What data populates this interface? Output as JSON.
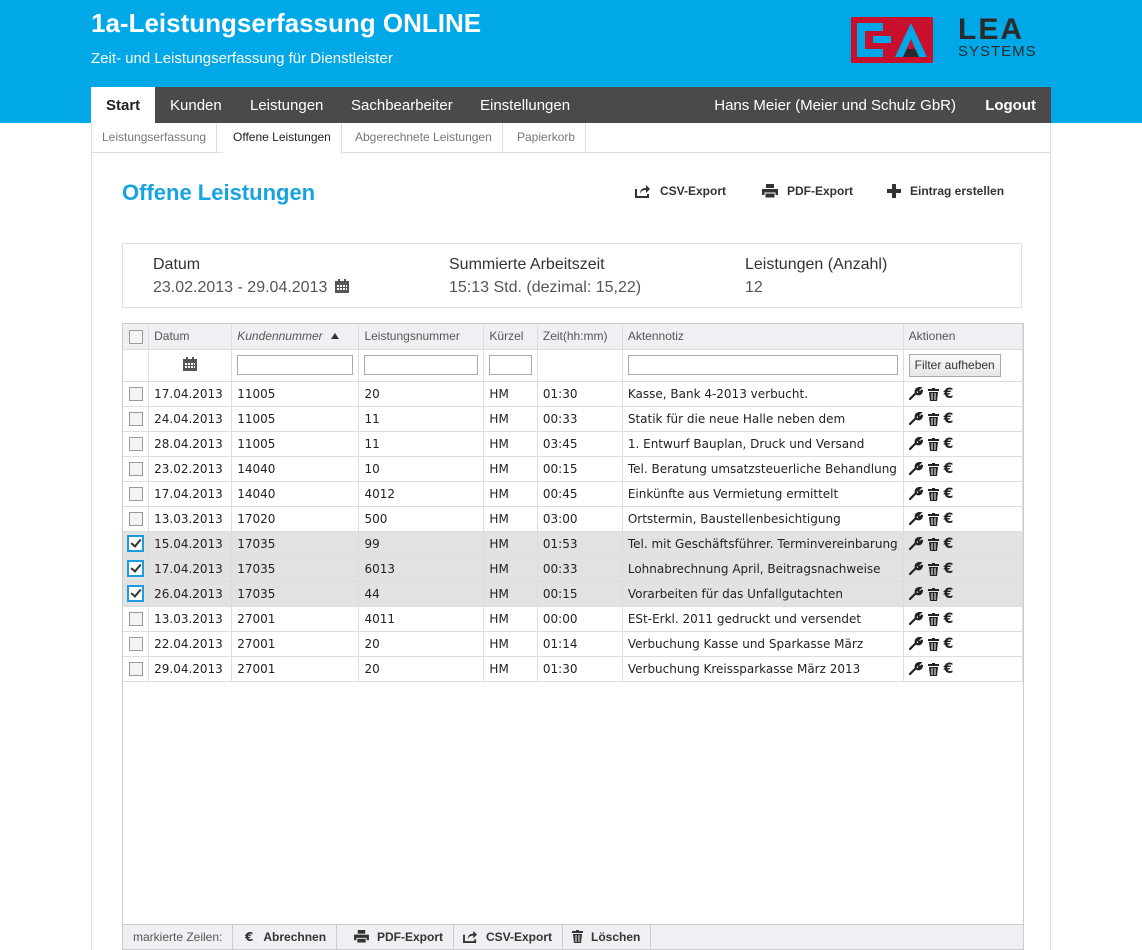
{
  "app": {
    "title": "1a-Leistungserfassung ONLINE",
    "subtitle": "Zeit- und Leistungserfassung für Dienstleister",
    "logo_line1": "LEA",
    "logo_line2": "SYSTEMS",
    "accent_color": "#00a8e8"
  },
  "nav": {
    "items": [
      {
        "label": "Start",
        "active": true
      },
      {
        "label": "Kunden"
      },
      {
        "label": "Leistungen"
      },
      {
        "label": "Sachbearbeiter"
      },
      {
        "label": "Einstellungen"
      }
    ],
    "user": "Hans Meier (Meier und Schulz GbR)",
    "logout": "Logout"
  },
  "subnav": {
    "items": [
      {
        "label": "Leistungserfassung"
      },
      {
        "label": "Offene Leistungen",
        "active": true
      },
      {
        "label": "Abgerechnete Leistungen"
      },
      {
        "label": "Papierkorb"
      }
    ]
  },
  "page": {
    "title": "Offene Leistungen",
    "actions": {
      "csv": "CSV-Export",
      "pdf": "PDF-Export",
      "create": "Eintrag erstellen"
    }
  },
  "summary": {
    "date_label": "Datum",
    "date_value": "23.02.2013 - 29.04.2013",
    "time_label": "Summierte Arbeitszeit",
    "time_value": "15:13 Std. (dezimal: 15,22)",
    "count_label": "Leistungen (Anzahl)",
    "count_value": "12"
  },
  "table": {
    "columns": [
      "Datum",
      "Kundennummer",
      "Leistungsnummer",
      "Kürzel",
      "Zeit(hh:mm)",
      "Aktennotiz",
      "Aktionen"
    ],
    "sorted_column": "Kundennummer",
    "filter_button": "Filter aufheben",
    "rows": [
      {
        "date": "17.04.2013",
        "customer": "11005",
        "service": "20",
        "abbr": "HM",
        "time": "01:30",
        "note": "Kasse, Bank 4-2013 verbucht.",
        "checked": false
      },
      {
        "date": "24.04.2013",
        "customer": "11005",
        "service": "11",
        "abbr": "HM",
        "time": "00:33",
        "note": "Statik für die neue Halle neben dem",
        "checked": false
      },
      {
        "date": "28.04.2013",
        "customer": "11005",
        "service": "11",
        "abbr": "HM",
        "time": "03:45",
        "note": "1. Entwurf Bauplan, Druck und Versand",
        "checked": false
      },
      {
        "date": "23.02.2013",
        "customer": "14040",
        "service": "10",
        "abbr": "HM",
        "time": "00:15",
        "note": "Tel. Beratung umsatzsteuerliche Behandlung",
        "checked": false
      },
      {
        "date": "17.04.2013",
        "customer": "14040",
        "service": "4012",
        "abbr": "HM",
        "time": "00:45",
        "note": "Einkünfte aus Vermietung ermittelt",
        "checked": false
      },
      {
        "date": "13.03.2013",
        "customer": "17020",
        "service": "500",
        "abbr": "HM",
        "time": "03:00",
        "note": "Ortstermin, Baustellenbesichtigung",
        "checked": false
      },
      {
        "date": "15.04.2013",
        "customer": "17035",
        "service": "99",
        "abbr": "HM",
        "time": "01:53",
        "note": "Tel. mit Geschäftsführer. Terminvereinbarung",
        "checked": true
      },
      {
        "date": "17.04.2013",
        "customer": "17035",
        "service": "6013",
        "abbr": "HM",
        "time": "00:33",
        "note": "Lohnabrechnung April, Beitragsnachweise",
        "checked": true
      },
      {
        "date": "26.04.2013",
        "customer": "17035",
        "service": "44",
        "abbr": "HM",
        "time": "00:15",
        "note": "Vorarbeiten für das Unfallgutachten",
        "checked": true
      },
      {
        "date": "13.03.2013",
        "customer": "27001",
        "service": "4011",
        "abbr": "HM",
        "time": "00:00",
        "note": "ESt-Erkl. 2011 gedruckt und versendet",
        "checked": false
      },
      {
        "date": "22.04.2013",
        "customer": "27001",
        "service": "20",
        "abbr": "HM",
        "time": "01:14",
        "note": "Verbuchung Kasse und Sparkasse März",
        "checked": false
      },
      {
        "date": "29.04.2013",
        "customer": "27001",
        "service": "20",
        "abbr": "HM",
        "time": "01:30",
        "note": "Verbuchung Kreissparkasse März 2013",
        "checked": false
      }
    ]
  },
  "bottombar": {
    "label": "markierte Zeilen:",
    "euro_symbol": "€",
    "bill": "Abrechnen",
    "pdf": "PDF-Export",
    "csv": "CSV-Export",
    "delete": "Löschen"
  }
}
